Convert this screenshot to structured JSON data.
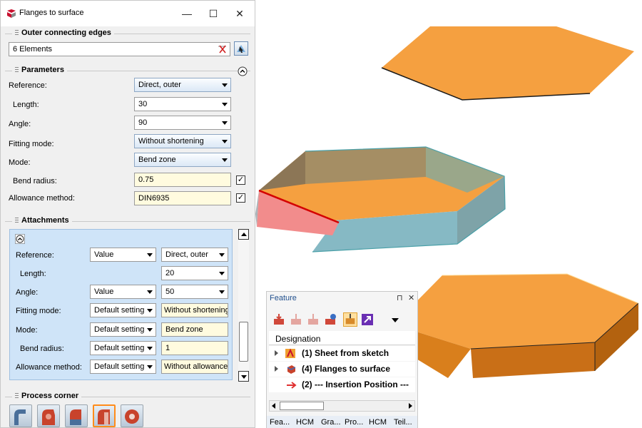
{
  "window": {
    "title": "Flanges to surface",
    "minimize": "—",
    "maximize": "☐",
    "close": "✕"
  },
  "outer_edges": {
    "title": "Outer connecting edges",
    "value": "6 Elements"
  },
  "parameters": {
    "title": "Parameters",
    "reference": {
      "label": "Reference:",
      "value": "Direct, outer"
    },
    "length": {
      "label": "Length:",
      "value": "30"
    },
    "angle": {
      "label": "Angle:",
      "value": "90"
    },
    "fitting_mode": {
      "label": "Fitting mode:",
      "value": "Without shortening"
    },
    "mode": {
      "label": "Mode:",
      "value": "Bend zone"
    },
    "bend_radius": {
      "label": "Bend radius:",
      "value": "0.75",
      "checked": true
    },
    "allowance": {
      "label": "Allowance method:",
      "value": "DIN6935",
      "checked": true
    }
  },
  "attachments": {
    "title": "Attachments",
    "reference": {
      "label": "Reference:",
      "mode": "Value",
      "value": "Direct, outer"
    },
    "length": {
      "label": "Length:",
      "value": "20"
    },
    "angle": {
      "label": "Angle:",
      "mode": "Value",
      "value": "50"
    },
    "fitting_mode": {
      "label": "Fitting mode:",
      "mode": "Default setting",
      "value": "Without shortening"
    },
    "mode": {
      "label": "Mode:",
      "mode": "Default setting",
      "value": "Bend zone"
    },
    "bend_radius": {
      "label": "Bend radius:",
      "mode": "Default setting",
      "value": "1"
    },
    "allowance": {
      "label": "Allowance method:",
      "mode": "Default setting",
      "value": "Without allowance"
    }
  },
  "process_corner": {
    "title": "Process corner"
  },
  "feature_panel": {
    "title": "Feature",
    "pin": "⊓",
    "close": "✕",
    "column_header": "Designation",
    "items": [
      {
        "label": "(1) Sheet from sketch"
      },
      {
        "label": "(4) Flanges to surface"
      },
      {
        "label": "(2) --- Insertion Position ---"
      }
    ],
    "tabs": [
      "Fea...",
      "HCM",
      "Gra...",
      "Pro...",
      "HCM",
      "Teil..."
    ]
  },
  "colors": {
    "accent": "#ff8c1a",
    "sheet_orange": "#f5a040",
    "attach_bg": "#cfe4f8",
    "feature_title": "#1f4e8c"
  }
}
